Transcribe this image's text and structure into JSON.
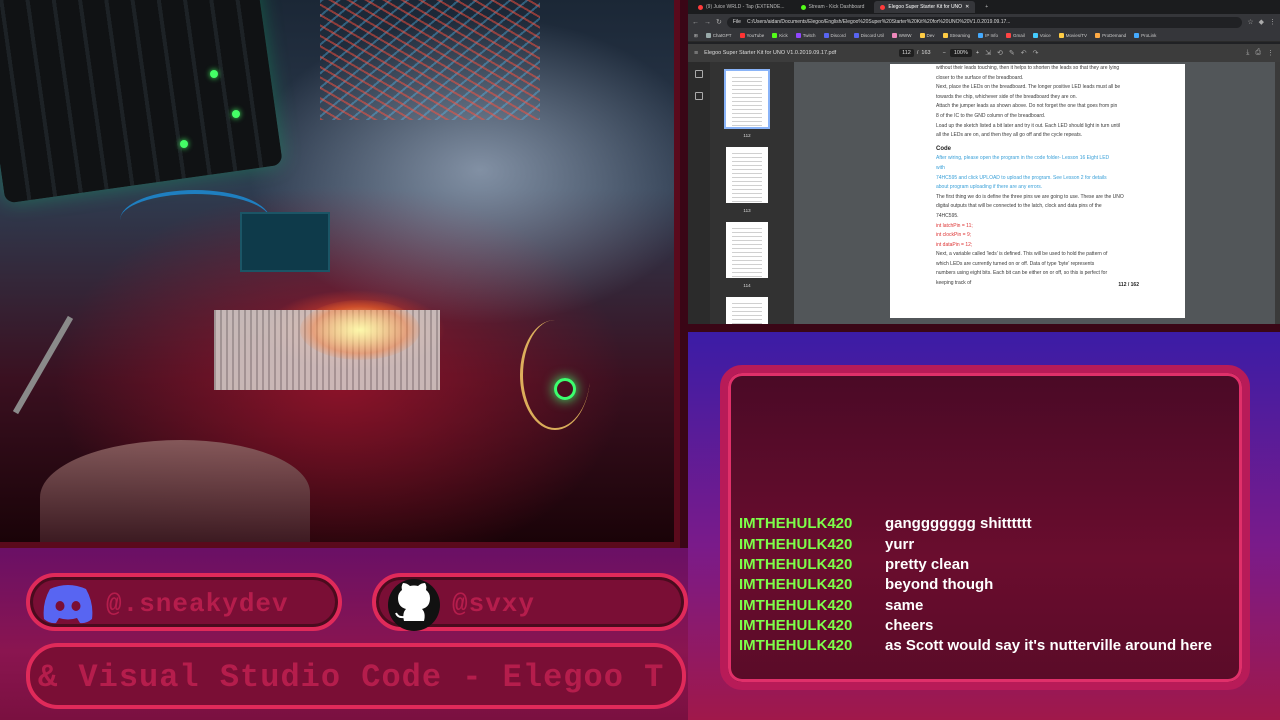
{
  "browser": {
    "tabs": [
      {
        "label": "(9) Juice WRLD - Tap (EXTENDE...",
        "color": "#ff3b3b"
      },
      {
        "label": "Stream - Kick Dashboard",
        "color": "#53fc18"
      },
      {
        "label": "Elegoo Super Starter Kit for UNO",
        "color": "#ff3b3b",
        "active": true
      }
    ],
    "url_scheme": "File",
    "url": "C:/Users/aidan/Documents/Elegoo/English/Elegoo%20Super%20Starter%20Kit%20for%20UNO%20V1.0.2019.09.17...",
    "bookmarks": [
      {
        "label": "ChatGPT",
        "color": "#9aa"
      },
      {
        "label": "YouTube",
        "color": "#f33"
      },
      {
        "label": "Kick",
        "color": "#53fc18"
      },
      {
        "label": "Twitch",
        "color": "#9146ff"
      },
      {
        "label": "Discord",
        "color": "#5865f2"
      },
      {
        "label": "Discord Util",
        "color": "#5865f2"
      },
      {
        "label": "WWW",
        "color": "#e8b"
      },
      {
        "label": "Dev",
        "color": "#fc4"
      },
      {
        "label": "Streaming",
        "color": "#fc4"
      },
      {
        "label": "IP Info",
        "color": "#4af"
      },
      {
        "label": "Gmail",
        "color": "#f44"
      },
      {
        "label": "Voice",
        "color": "#4cf"
      },
      {
        "label": "Movies/TV",
        "color": "#fc4"
      },
      {
        "label": "ProDemand",
        "color": "#fa4"
      },
      {
        "label": "ProLink",
        "color": "#4af"
      }
    ]
  },
  "pdf": {
    "title": "Elegoo Super Starter Kit for UNO V1.0.2019.09.17.pdf",
    "page_current": "112",
    "page_sep": "/",
    "page_total": "163",
    "zoom": "100%",
    "thumbnails": [
      "112",
      "113",
      "114"
    ],
    "page_footer": "112 / 162",
    "lines": [
      {
        "t": "without their leads touching, then it helps to shorten the leads so that they are lying",
        "s": ""
      },
      {
        "t": "closer to the surface of the breadboard.",
        "s": ""
      },
      {
        "t": "Next, place the LEDs on the breadboard.  The longer positive LED leads must all be",
        "s": ""
      },
      {
        "t": "towards the chip, whichever side of the breadboard they are on.",
        "s": ""
      },
      {
        "t": "Attach the jumper leads as shown above. Do not forget the one that goes from pin",
        "s": ""
      },
      {
        "t": "8 of the IC to the GND column of the breadboard.",
        "s": ""
      },
      {
        "t": "Load up the sketch listed a bit later and try it out. Each LED should light in turn until",
        "s": ""
      },
      {
        "t": "all the LEDs are on, and then they all go off and the cycle repeats.",
        "s": ""
      },
      {
        "t": "Code",
        "s": "head"
      },
      {
        "t": "After wiring, please open the program in the code folder- Lesson 16 Eight LED",
        "s": "blue"
      },
      {
        "t": "with",
        "s": "blue"
      },
      {
        "t": "74HC595 and click UPLOAD to upload the program. See Lesson 2 for details",
        "s": "blue"
      },
      {
        "t": "about program uploading if there are any errors.",
        "s": "blue"
      },
      {
        "t": "The first thing we do is define the three pins we are going to use. These are the UNO",
        "s": ""
      },
      {
        "t": "digital outputs that will be connected to the latch, clock and data pins of the",
        "s": ""
      },
      {
        "t": "74HC595.",
        "s": ""
      },
      {
        "t": "int latchPin = 11;",
        "s": "red"
      },
      {
        "t": "int clockPin = 9;",
        "s": "red"
      },
      {
        "t": "int dataPin = 12;",
        "s": "red"
      },
      {
        "t": "Next, a variable called 'leds' is defined. This will be used to hold the pattern of",
        "s": ""
      },
      {
        "t": "which LEDs are currently turned on or off. Data of type 'byte' represents",
        "s": ""
      },
      {
        "t": "numbers using eight bits. Each bit can be either on or off, so this is perfect for",
        "s": ""
      },
      {
        "t": "keeping track of",
        "s": ""
      }
    ]
  },
  "chat": {
    "messages": [
      {
        "user": "IMTHEHULK420",
        "text": "ganggggggg shitttttt"
      },
      {
        "user": "IMTHEHULK420",
        "text": "yurr"
      },
      {
        "user": "IMTHEHULK420",
        "text": "pretty clean"
      },
      {
        "user": "IMTHEHULK420",
        "text": "beyond though"
      },
      {
        "user": "IMTHEHULK420",
        "text": "same"
      },
      {
        "user": "IMTHEHULK420",
        "text": "cheers"
      },
      {
        "user": "IMTHEHULK420",
        "text": "as Scott would say it's nutterville around here"
      }
    ]
  },
  "socials": {
    "discord": "@.sneakydev",
    "github": "@svxy"
  },
  "ticker": "& Visual Studio Code - Elegoo T",
  "colors": {
    "username": "#7dff4a",
    "accent_pink": "#e02a5a",
    "chat_bg": "#6a0d2e"
  }
}
